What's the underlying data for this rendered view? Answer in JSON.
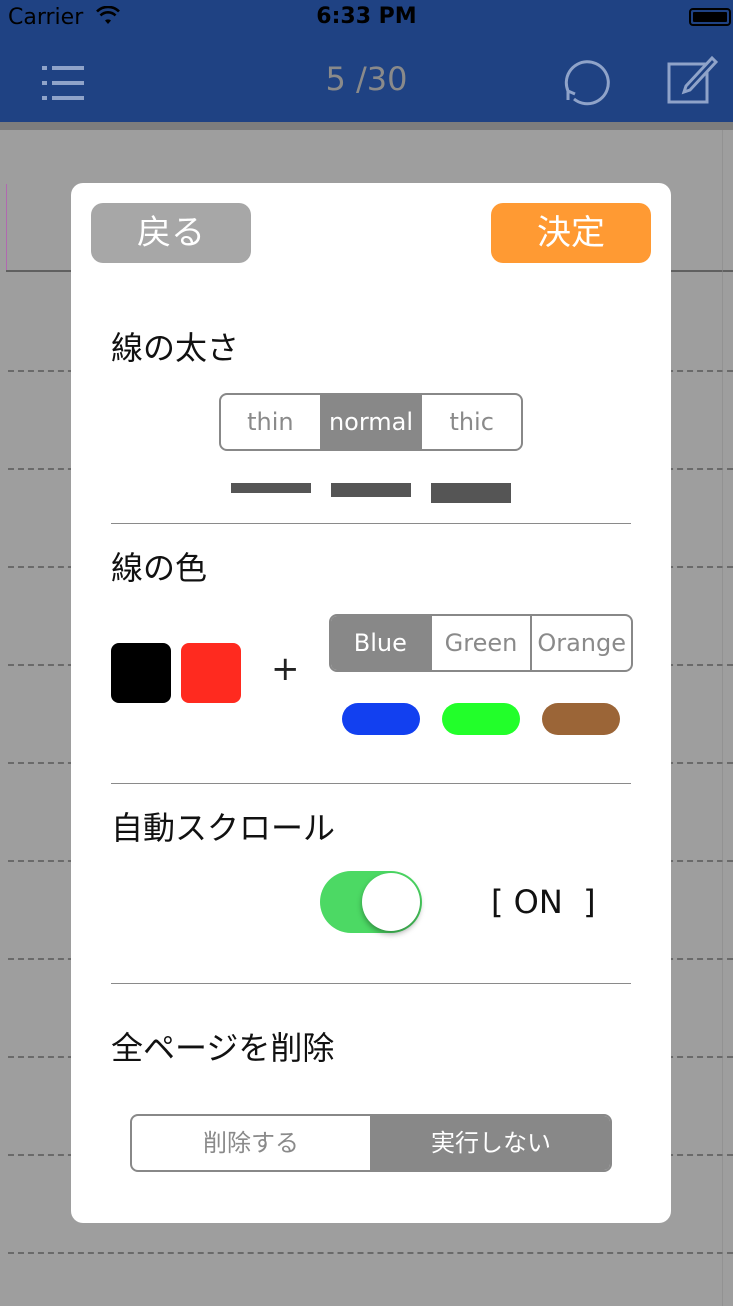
{
  "status_bar": {
    "carrier": "Carrier",
    "time": "6:33 PM"
  },
  "nav": {
    "title": "5 /30",
    "left_icon": "list-icon",
    "history_icon": "history-icon",
    "edit_icon": "compose-icon"
  },
  "modal": {
    "back_label": "戻る",
    "ok_label": "決定",
    "line_width": {
      "title": "線の太さ",
      "options": [
        "thin",
        "normal",
        "thic"
      ],
      "selected": "normal"
    },
    "line_color": {
      "title": "線の色",
      "fixed_swatches": [
        "#000000",
        "#ff2a1f"
      ],
      "plus": "+",
      "options": [
        "Blue",
        "Green",
        "Orange"
      ],
      "selected": "Blue",
      "option_colors": [
        "#1240f0",
        "#22ff2a",
        "#9b6537"
      ]
    },
    "auto_scroll": {
      "title": "自動スクロール",
      "toggle_on": true,
      "status": "[ ON  ]",
      "toggle_color": "#4cd964"
    },
    "delete_all": {
      "title": "全ページを削除",
      "options": [
        "削除する",
        "実行しない"
      ],
      "selected": "実行しない"
    }
  },
  "colors": {
    "nav_bar": "#1f4283",
    "back_button": "#a7a7a7",
    "ok_button": "#ff9a33",
    "segment_selected": "#888888"
  }
}
